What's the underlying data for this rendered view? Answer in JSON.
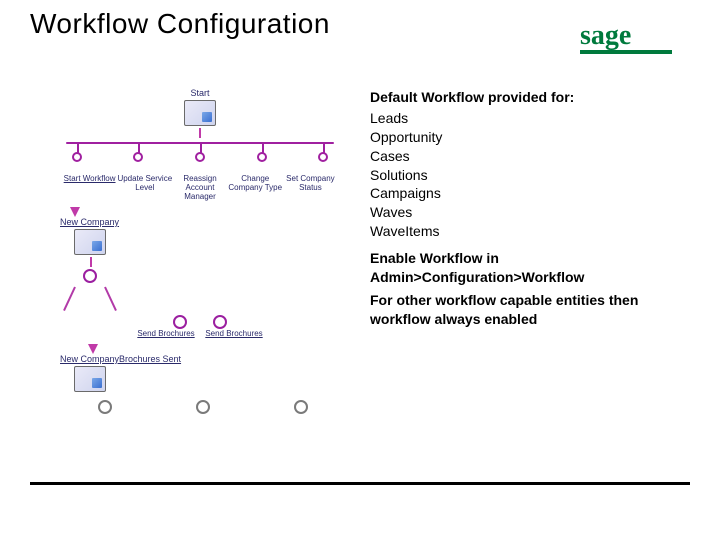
{
  "title": "Workflow Configuration",
  "logo_text": "sage",
  "text": {
    "heading": "Default Workflow provided for:",
    "items": [
      "Leads",
      "Opportunity",
      "Cases",
      "Solutions",
      "Campaigns",
      "Waves",
      "WaveItems"
    ],
    "enable": "Enable Workflow in Admin>Configuration>Workflow",
    "other": "For other workflow capable entities then workflow always enabled"
  },
  "diagram": {
    "start": "Start",
    "row5": [
      "Start Workflow",
      "Update Service Level",
      "Reassign Account Manager",
      "Change Company Type",
      "Set Company Status"
    ],
    "new_company": "New Company",
    "send_pair": [
      "Send Brochures",
      "Send Brochures"
    ],
    "sent": "New CompanyBrochures Sent"
  }
}
